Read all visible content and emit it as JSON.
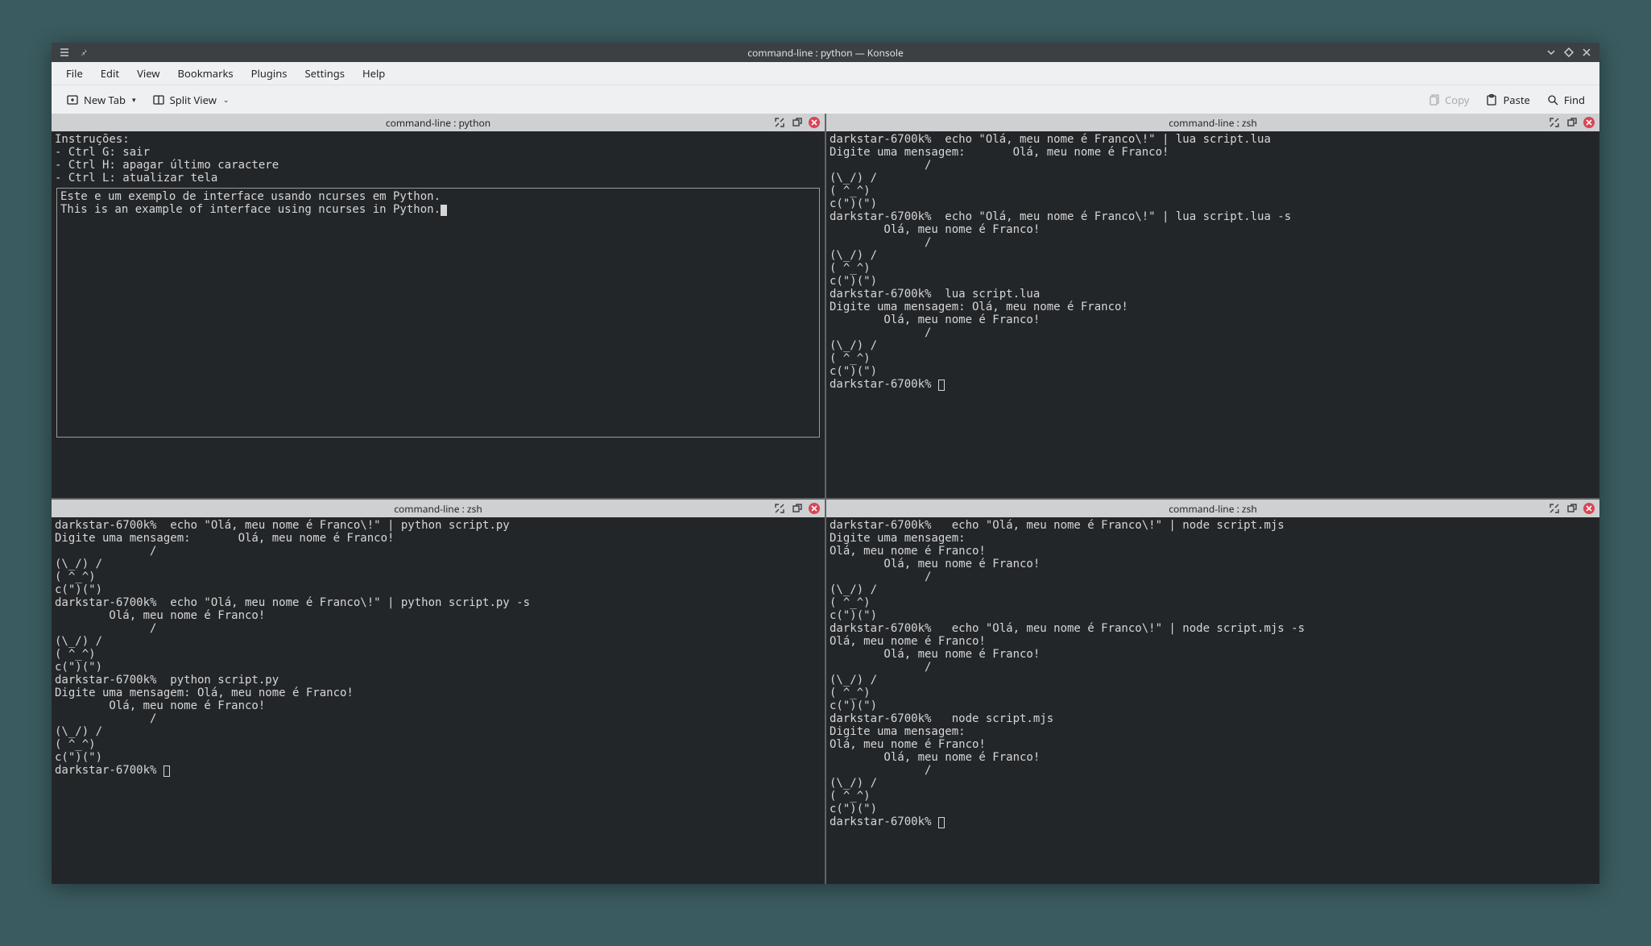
{
  "titlebar": {
    "title": "command-line : python — Konsole"
  },
  "menu": {
    "file": "File",
    "edit": "Edit",
    "view": "View",
    "bookmarks": "Bookmarks",
    "plugins": "Plugins",
    "settings": "Settings",
    "help": "Help"
  },
  "toolbar": {
    "new_tab": "New Tab",
    "split_view": "Split View",
    "copy": "Copy",
    "paste": "Paste",
    "find": "Find"
  },
  "panes": {
    "top_left": {
      "title": "command-line : python",
      "intro": "Instruções:\n- Ctrl G: sair\n- Ctrl H: apagar último caractere\n- Ctrl L: atualizar tela",
      "box": "Este e um exemplo de interface usando ncurses em Python.\nThis is an example of interface using ncurses in Python."
    },
    "top_right": {
      "title": "command-line : zsh",
      "body": "darkstar-6700k%  echo \"Olá, meu nome é Franco\\!\" | lua script.lua\nDigite uma mensagem:       Olá, meu nome é Franco!\n              /\n(\\_/) /\n( ^_^)\nc(\")(\")\ndarkstar-6700k%  echo \"Olá, meu nome é Franco\\!\" | lua script.lua -s\n        Olá, meu nome é Franco!\n              /\n(\\_/) /\n( ^_^)\nc(\")(\")\ndarkstar-6700k%  lua script.lua\nDigite uma mensagem: Olá, meu nome é Franco!\n        Olá, meu nome é Franco!\n              /\n(\\_/) /\n( ^_^)\nc(\")(\")\ndarkstar-6700k% "
    },
    "bottom_left": {
      "title": "command-line : zsh",
      "body": "darkstar-6700k%  echo \"Olá, meu nome é Franco\\!\" | python script.py\nDigite uma mensagem:       Olá, meu nome é Franco!\n              /\n(\\_/) /\n( ^_^)\nc(\")(\")\ndarkstar-6700k%  echo \"Olá, meu nome é Franco\\!\" | python script.py -s\n        Olá, meu nome é Franco!\n              /\n(\\_/) /\n( ^_^)\nc(\")(\")\ndarkstar-6700k%  python script.py\nDigite uma mensagem: Olá, meu nome é Franco!\n        Olá, meu nome é Franco!\n              /\n(\\_/) /\n( ^_^)\nc(\")(\")\ndarkstar-6700k% "
    },
    "bottom_right": {
      "title": "command-line : zsh",
      "body": "darkstar-6700k%   echo \"Olá, meu nome é Franco\\!\" | node script.mjs\nDigite uma mensagem:\nOlá, meu nome é Franco!\n        Olá, meu nome é Franco!\n              /\n(\\_/) /\n( ^_^)\nc(\")(\")\ndarkstar-6700k%   echo \"Olá, meu nome é Franco\\!\" | node script.mjs -s\nOlá, meu nome é Franco!\n        Olá, meu nome é Franco!\n              /\n(\\_/) /\n( ^_^)\nc(\")(\")\ndarkstar-6700k%   node script.mjs\nDigite uma mensagem:\nOlá, meu nome é Franco!\n        Olá, meu nome é Franco!\n              /\n(\\_/) /\n( ^_^)\nc(\")(\")\ndarkstar-6700k% "
    }
  }
}
